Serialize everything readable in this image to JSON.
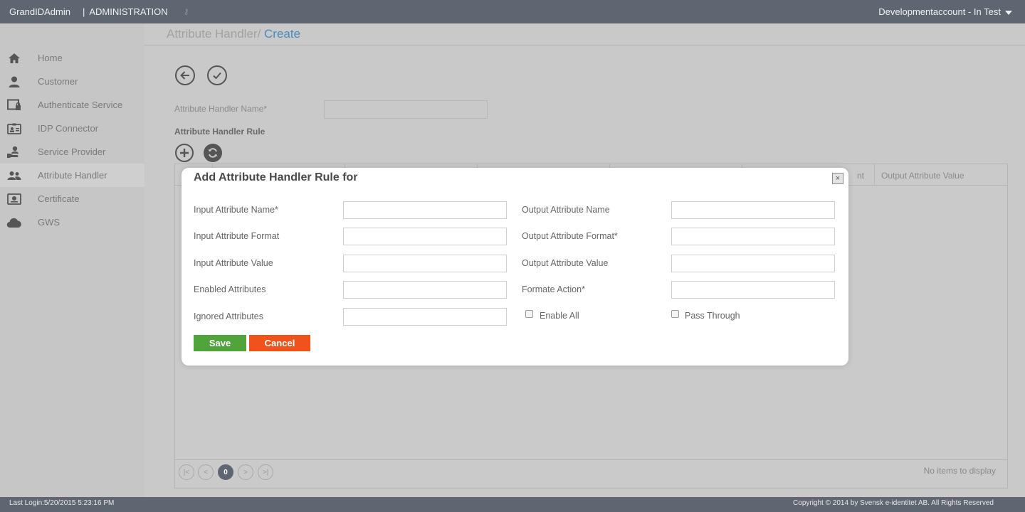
{
  "topbar": {
    "brand": "GrandIDAdmin",
    "separator": "|",
    "section": "ADMINISTRATION",
    "account": "Developmentaccount - In Test"
  },
  "sidebar": {
    "items": [
      {
        "label": "Home",
        "icon": "home-icon"
      },
      {
        "label": "Customer",
        "icon": "user-icon"
      },
      {
        "label": "Authenticate Service",
        "icon": "lock-window-icon"
      },
      {
        "label": "IDP Connector",
        "icon": "id-card-icon"
      },
      {
        "label": "Service Provider",
        "icon": "hand-user-icon"
      },
      {
        "label": "Attribute Handler",
        "icon": "users-icon"
      },
      {
        "label": "Certificate",
        "icon": "certificate-icon"
      },
      {
        "label": "GWS",
        "icon": "cloud-icon"
      }
    ],
    "active_index": 5
  },
  "breadcrumb": {
    "parent": "Attribute Handler/",
    "current": " Create"
  },
  "form": {
    "name_label": "Attribute Handler Name*",
    "name_value": "",
    "rule_title": "Attribute Handler Rule"
  },
  "grid": {
    "visible_header_fragment": "nt",
    "last_header": "Output Attribute Value",
    "pager_current": "0",
    "empty_text": "No items to display"
  },
  "modal": {
    "title": "Add Attribute Handler Rule for",
    "close": "×",
    "left_fields": [
      {
        "label": "Input Attribute Name*",
        "value": ""
      },
      {
        "label": "Input Attribute Format",
        "value": ""
      },
      {
        "label": "Input Attribute Value",
        "value": ""
      },
      {
        "label": "Enabled Attributes",
        "value": ""
      },
      {
        "label": "Ignored Attributes",
        "value": ""
      }
    ],
    "right_fields": [
      {
        "label": "Output Attribute Name",
        "value": ""
      },
      {
        "label": "Output Attribute Format*",
        "value": ""
      },
      {
        "label": "Output Attribute Value",
        "value": ""
      },
      {
        "label": "Formate Action*",
        "value": ""
      }
    ],
    "checkboxes": [
      {
        "label": "Enable All",
        "checked": false
      },
      {
        "label": "Pass Through",
        "checked": false
      }
    ],
    "save_label": "Save",
    "cancel_label": "Cancel"
  },
  "footer": {
    "last_login": "Last Login:5/20/2015 5:23:16 PM",
    "copyright": "Copyright © 2014 by Svensk e-identitet AB. All Rights Reserved"
  },
  "colors": {
    "topbar": "#5f6672",
    "link": "#4a8cbd",
    "save": "#51a33b",
    "cancel": "#f0521b"
  }
}
